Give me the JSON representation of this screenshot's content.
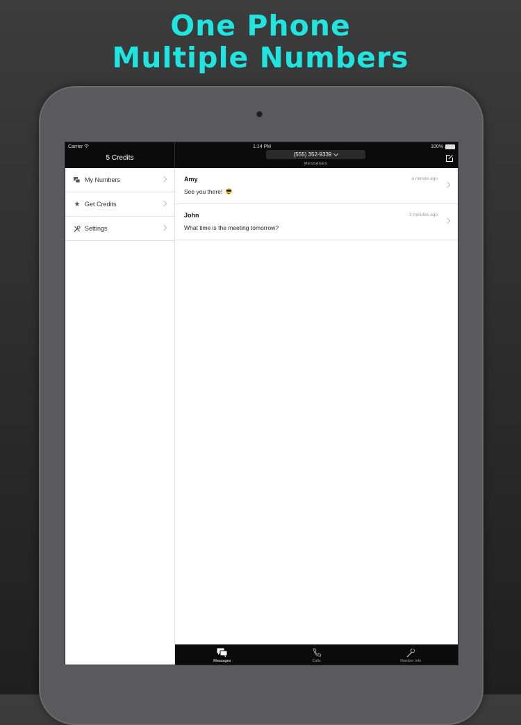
{
  "promo": {
    "line1": "One Phone",
    "line2": "Multiple Numbers",
    "color": "#20e4df"
  },
  "status_bar": {
    "carrier": "Carrier",
    "time": "1:14 PM",
    "battery": "100%"
  },
  "sidebar": {
    "title": "5 Credits",
    "items": [
      {
        "label": "My Numbers",
        "icon": "numbers-icon"
      },
      {
        "label": "Get Credits",
        "icon": "star-icon"
      },
      {
        "label": "Settings",
        "icon": "tools-icon"
      }
    ]
  },
  "header": {
    "phone_number": "(555) 352-9339",
    "subtitle": "MESSAGES"
  },
  "messages": [
    {
      "name": "Amy",
      "time": "a minute ago",
      "text": "See you there!"
    },
    {
      "name": "John",
      "time": "3 minutes ago",
      "text": "What time is the meeting tomorrow?"
    }
  ],
  "tabs": [
    {
      "label": "Messages",
      "icon": "messages-icon",
      "active": true
    },
    {
      "label": "Calls",
      "icon": "phone-icon",
      "active": false
    },
    {
      "label": "Number Info",
      "icon": "wrench-icon",
      "active": false
    }
  ]
}
